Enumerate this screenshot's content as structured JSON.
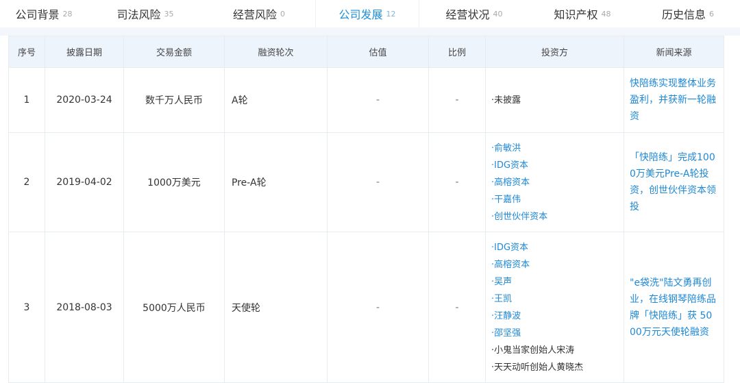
{
  "tabs": [
    {
      "label": "公司背景",
      "count": "28"
    },
    {
      "label": "司法风险",
      "count": "35"
    },
    {
      "label": "经营风险",
      "count": "0"
    },
    {
      "label": "公司发展",
      "count": "12"
    },
    {
      "label": "经营状况",
      "count": "40"
    },
    {
      "label": "知识产权",
      "count": "48"
    },
    {
      "label": "历史信息",
      "count": "6"
    }
  ],
  "active_tab": "公司发展",
  "colors": {
    "accent": "#1e90d6",
    "header_bg": "#eef4fb",
    "link": "#1e88d6"
  },
  "table": {
    "headers": [
      "序号",
      "披露日期",
      "交易金额",
      "融资轮次",
      "估值",
      "比例",
      "投资方",
      "新闻来源"
    ],
    "rows": [
      {
        "index": "1",
        "date": "2020-03-24",
        "amount": "数千万人民币",
        "round": "A轮",
        "valuation": "-",
        "ratio": "-",
        "investors": [
          "·未披露"
        ],
        "news": "快陪练实现整体业务盈利，并获新一轮融资"
      },
      {
        "index": "2",
        "date": "2019-04-02",
        "amount": "1000万美元",
        "round": "Pre-A轮",
        "valuation": "-",
        "ratio": "-",
        "investors": [
          "·俞敏洪",
          "·IDG资本",
          "·高榕资本",
          "·干嘉伟",
          "·创世伙伴资本"
        ],
        "news": "「快陪练」完成1000万美元Pre-A轮投资，创世伙伴资本领投"
      },
      {
        "index": "3",
        "date": "2018-08-03",
        "amount": "5000万人民币",
        "round": "天使轮",
        "valuation": "-",
        "ratio": "-",
        "investors": [
          "·IDG资本",
          "·高榕资本",
          "·吴声",
          "·王凯",
          "·汪静波",
          "·邵坚强",
          "·小鬼当家创始人宋涛",
          "·天天动听创始人黄晓杰"
        ],
        "news": "\"e袋洗\"陆文勇再创业，在线钢琴陪练品牌「快陪练」获 5000万元天使轮融资"
      }
    ]
  }
}
